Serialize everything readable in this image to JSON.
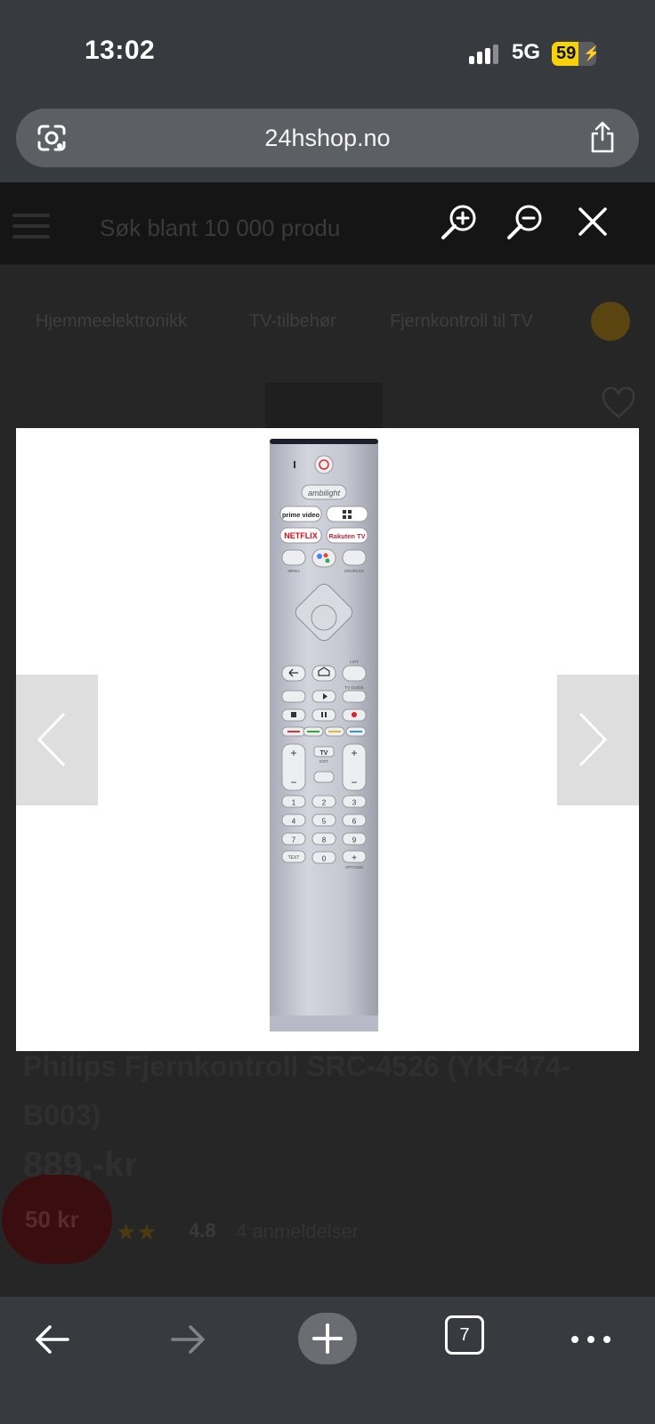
{
  "status_bar": {
    "time": "13:02",
    "network": "5G",
    "battery_level": "59",
    "battery_fraction": 0.59,
    "signal_bars": 3
  },
  "browser": {
    "url": "24hshop.no",
    "open_tabs": "7"
  },
  "site": {
    "search_placeholder": "Søk blant 10 000 produ",
    "breadcrumbs": [
      "Hjemmeelektronikk",
      "TV-tilbehør",
      "Fjernkontroll til TV"
    ]
  },
  "product": {
    "title": "Philips Fjernkontroll SRC-4526 (YKF474-B003)",
    "price": "889,-kr",
    "discount_badge": "50 kr",
    "rating": "4.8",
    "reviews": "4 anmeldelser"
  },
  "remote": {
    "brand_logo": "ambilight",
    "app_buttons": [
      "prime video",
      "NETFLIX",
      "Rakuten TV"
    ],
    "labels": {
      "menu": "MENU",
      "sources": "SOURCES",
      "list": "LIST",
      "tv_guide": "TV GUIDE",
      "exit": "EXIT",
      "text": "TEXT",
      "options": "OPTIONS",
      "tv": "TV",
      "pair": "PAIR"
    },
    "numbers": [
      "1",
      "2",
      "3",
      "4",
      "5",
      "6",
      "7",
      "8",
      "9",
      "0"
    ]
  },
  "colors": {
    "accent": "#f5d20a",
    "lightbox_bg": "#ffffff",
    "toolbar": "#373a3f"
  },
  "icons": [
    "google-lens-icon",
    "share-icon",
    "zoom-in-icon",
    "zoom-out-icon",
    "close-icon",
    "chevron-left-icon",
    "chevron-right-icon",
    "back-arrow-icon",
    "forward-arrow-icon",
    "plus-icon",
    "tabs-icon",
    "more-icon"
  ]
}
